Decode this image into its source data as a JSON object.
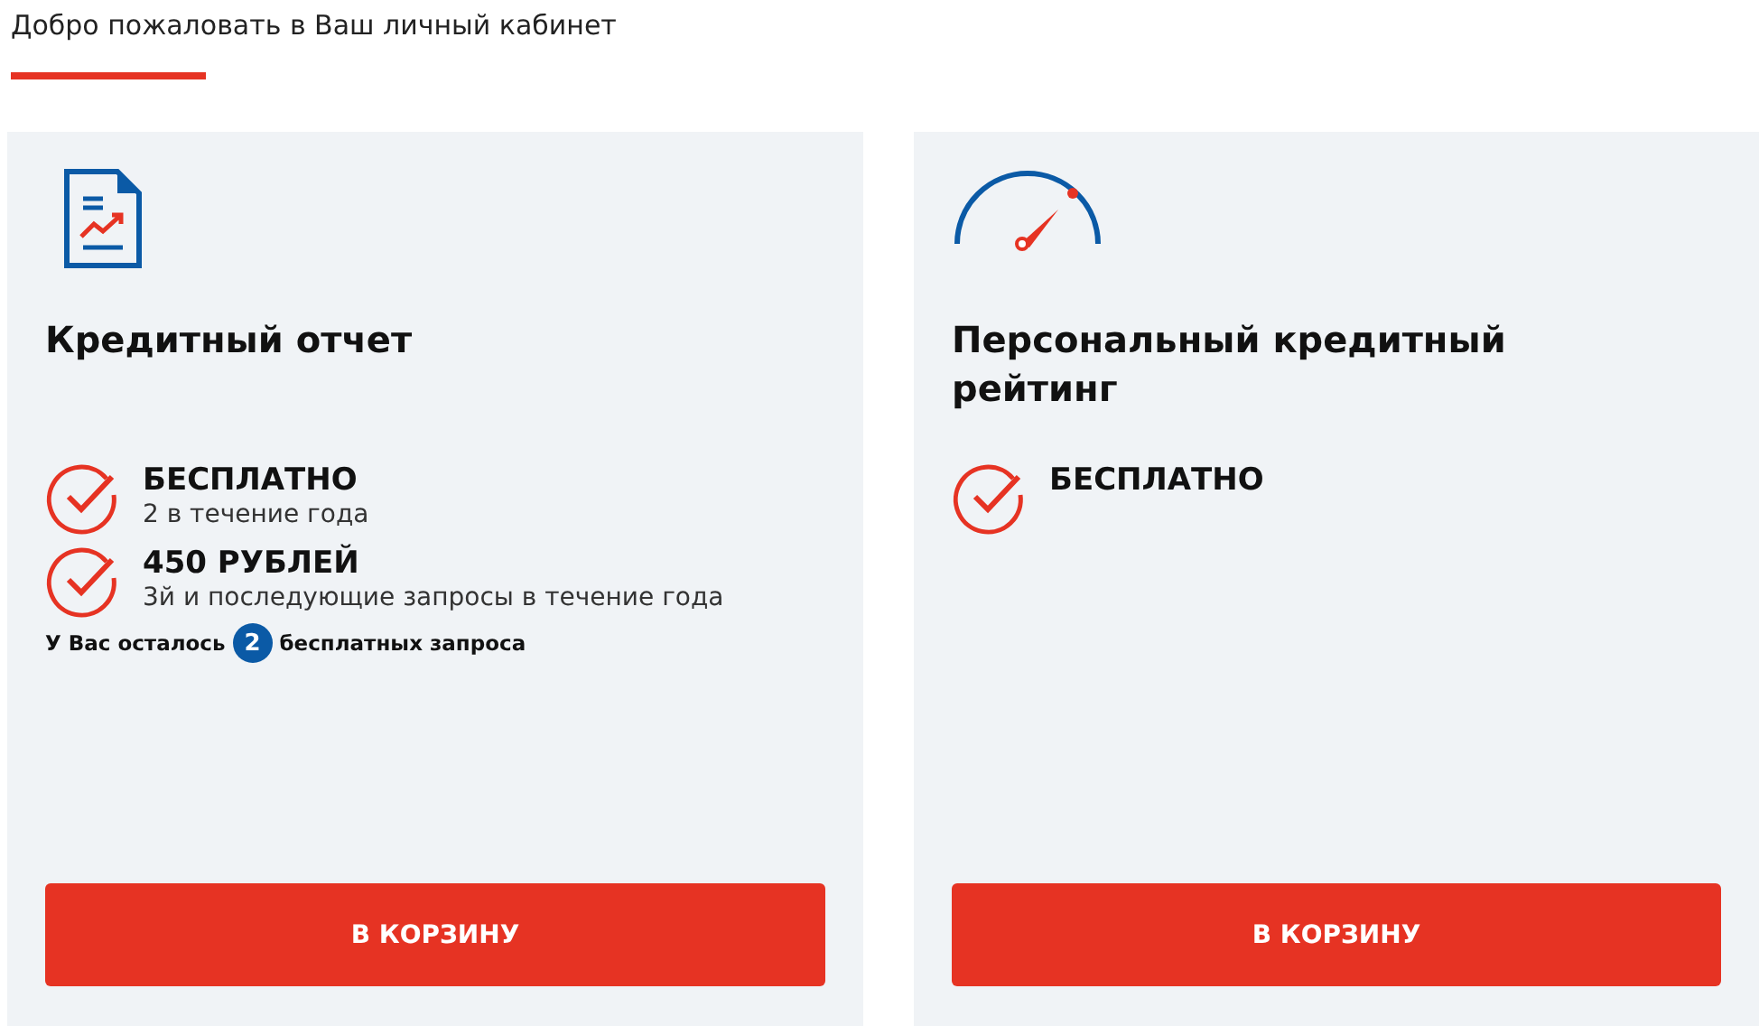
{
  "greeting": "Добро пожаловать в Ваш личный кабинет",
  "cards": [
    {
      "kind": "report",
      "title": "Кредитный отчет",
      "features": [
        {
          "title": "БЕСПЛАТНО",
          "subtitle": "2 в течение года"
        },
        {
          "title": "450 РУБЛЕЙ",
          "subtitle": "3й и последующие запросы в течение года"
        }
      ],
      "note": {
        "before": "У Вас осталось",
        "count": "2",
        "after": "бесплатных запроса"
      },
      "button": "В КОРЗИНУ"
    },
    {
      "kind": "gauge",
      "title": "Персональный кредитный рейтинг",
      "features": [
        {
          "title": "БЕСПЛАТНО"
        }
      ],
      "button": "В КОРЗИНУ"
    }
  ]
}
